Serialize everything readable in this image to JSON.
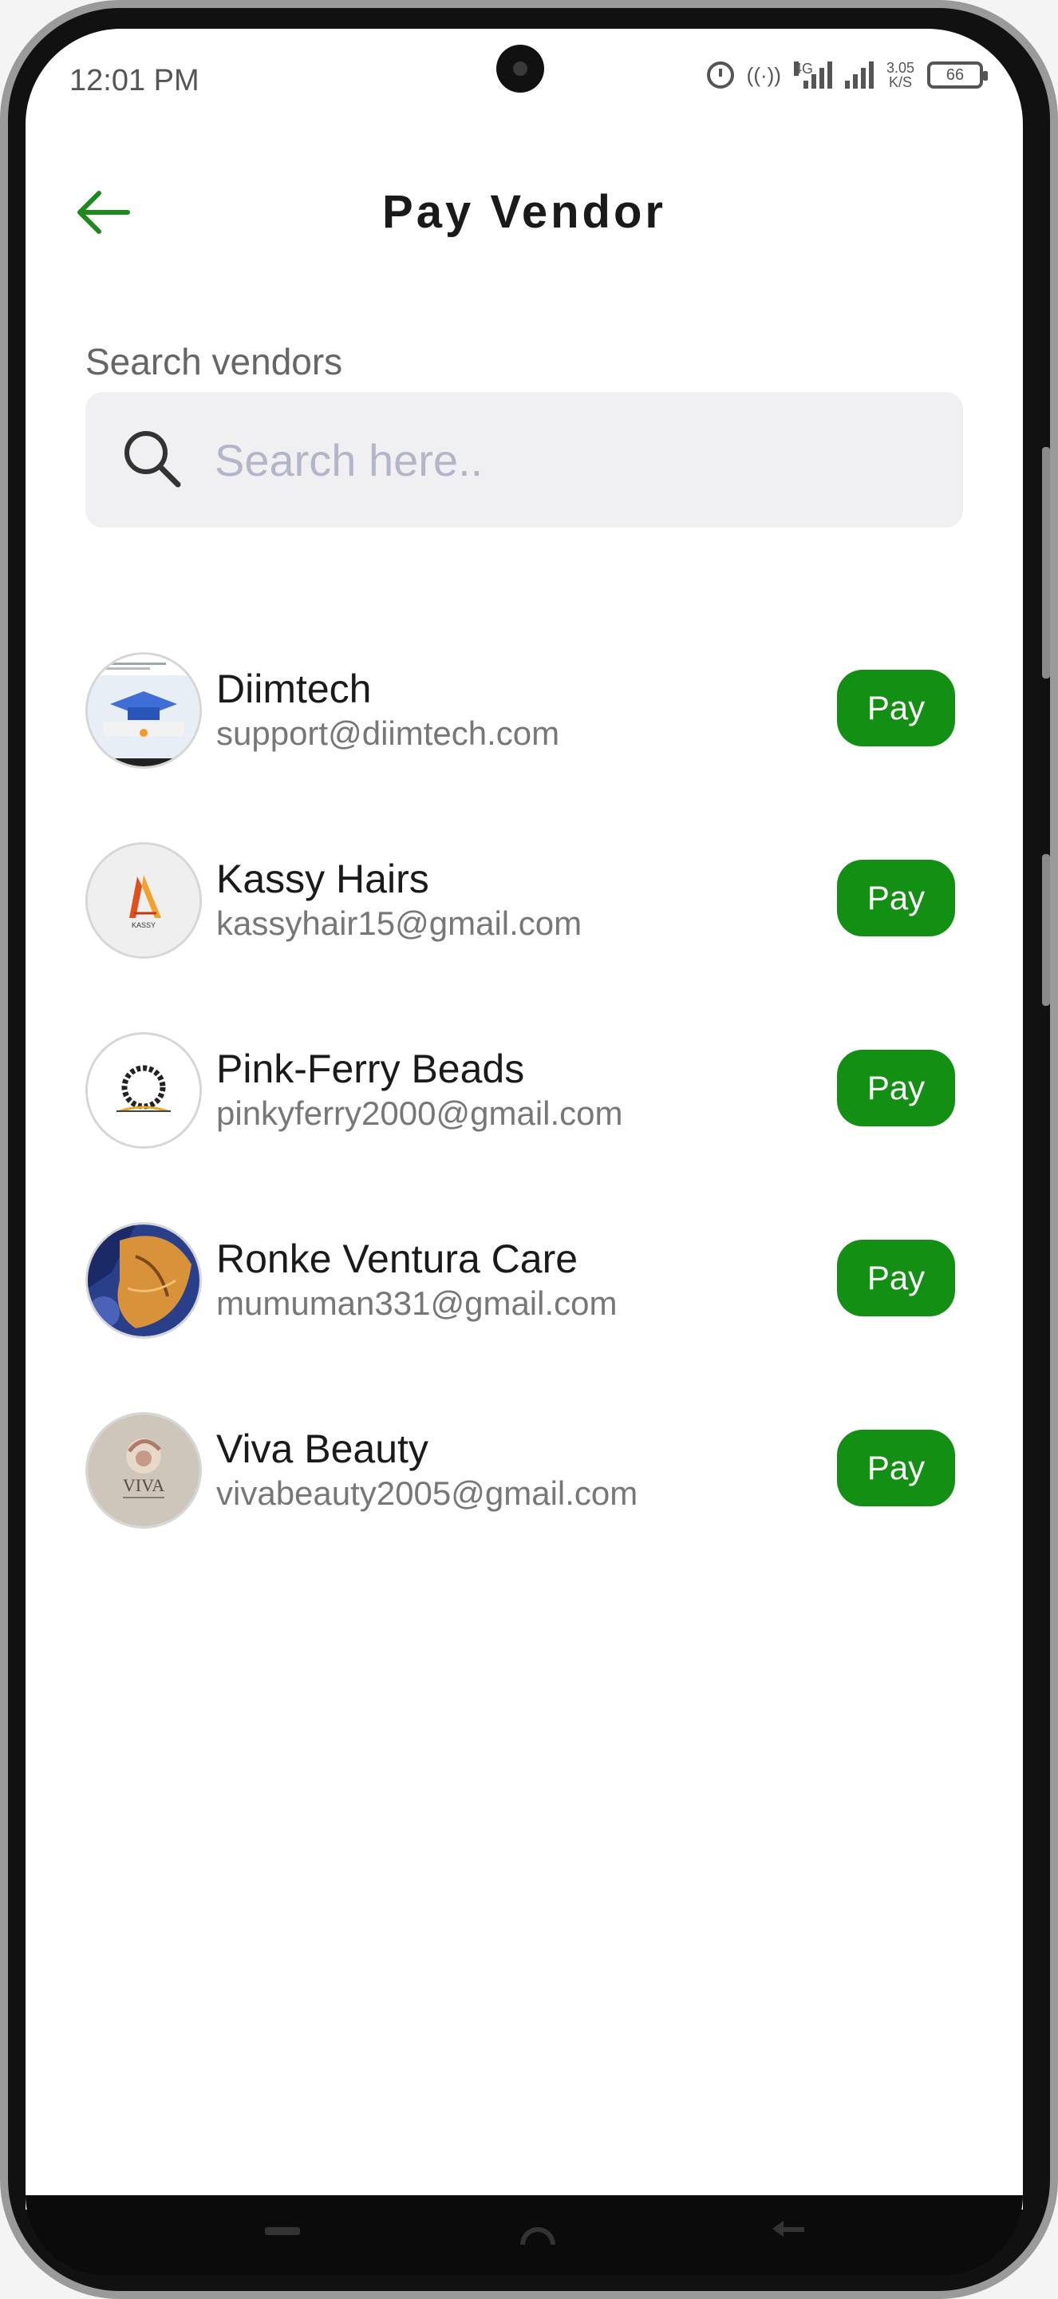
{
  "status_bar": {
    "time": "12:01 PM",
    "network_4g": "4G",
    "speed_value": "3.05",
    "speed_unit": "K/S",
    "battery": "66"
  },
  "header": {
    "title": "Pay Vendor",
    "back_icon": "arrow-left-icon"
  },
  "search": {
    "label": "Search vendors",
    "placeholder": "Search here..",
    "value": "",
    "icon": "search-icon"
  },
  "vendors": [
    {
      "name": "Diimtech",
      "email": "support@diimtech.com",
      "action": "Pay"
    },
    {
      "name": "Kassy Hairs",
      "email": "kassyhair15@gmail.com",
      "action": "Pay"
    },
    {
      "name": "Pink-Ferry Beads",
      "email": "pinkyferry2000@gmail.com",
      "action": "Pay"
    },
    {
      "name": "Ronke Ventura Care",
      "email": "mumuman331@gmail.com",
      "action": "Pay"
    },
    {
      "name": "Viva Beauty",
      "email": "vivabeauty2005@gmail.com",
      "action": "Pay"
    }
  ],
  "logo_text": {
    "kassy": "KASSY",
    "viva": "VIVA"
  },
  "colors": {
    "accent_green": "#139013",
    "back_arrow": "#1c8a1c",
    "placeholder": "#b3b6c6"
  }
}
